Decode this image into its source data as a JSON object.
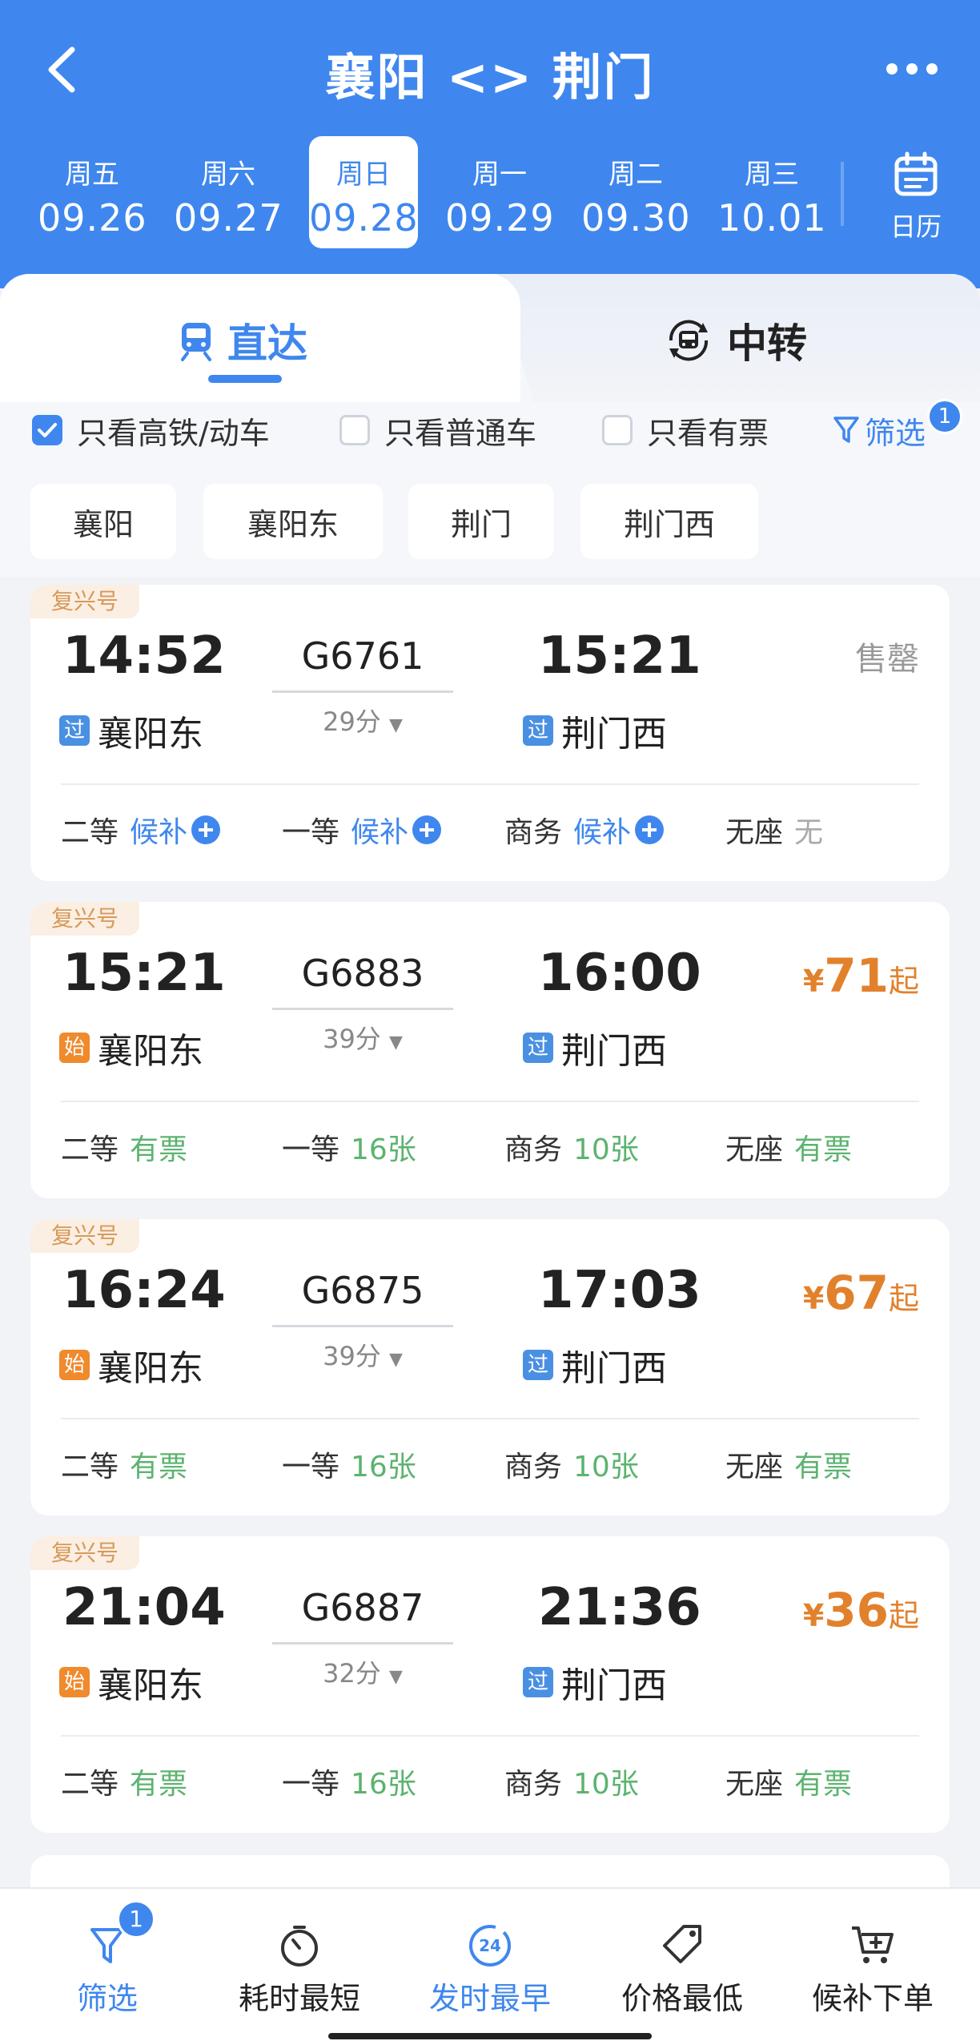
{
  "header": {
    "title": "襄阳 <> 荆门",
    "dates": [
      {
        "weekday": "周五",
        "date": "09.26"
      },
      {
        "weekday": "周六",
        "date": "09.27"
      },
      {
        "weekday": "周日",
        "date": "09.28",
        "selected": true
      },
      {
        "weekday": "周一",
        "date": "09.29"
      },
      {
        "weekday": "周二",
        "date": "09.30"
      },
      {
        "weekday": "周三",
        "date": "10.01"
      }
    ],
    "calendar_label": "日历"
  },
  "tabs": {
    "direct": "直达",
    "transfer": "中转"
  },
  "filters": {
    "high_speed": "只看高铁/动车",
    "high_speed_checked": true,
    "regular": "只看普通车",
    "regular_checked": false,
    "available": "只看有票",
    "available_checked": false,
    "filter_label": "筛选",
    "filter_badge": "1"
  },
  "stations": [
    "襄阳",
    "襄阳东",
    "荆门",
    "荆门西"
  ],
  "trains": [
    {
      "tag": "复兴号",
      "dep_time": "14:52",
      "arr_time": "15:21",
      "train_no": "G6761",
      "duration": "29分",
      "dep_mark": "过",
      "dep_station": "襄阳东",
      "arr_mark": "过",
      "arr_station": "荆门西",
      "sold_out": "售罄",
      "seats": [
        {
          "class": "二等",
          "status": "候补"
        },
        {
          "class": "一等",
          "status": "候补"
        },
        {
          "class": "商务",
          "status": "候补"
        },
        {
          "class": "无座",
          "status": "无"
        }
      ]
    },
    {
      "tag": "复兴号",
      "dep_time": "15:21",
      "arr_time": "16:00",
      "train_no": "G6883",
      "duration": "39分",
      "dep_mark": "始",
      "dep_station": "襄阳东",
      "arr_mark": "过",
      "arr_station": "荆门西",
      "price_symbol": "¥",
      "price": "71",
      "price_suffix": "起",
      "seats": [
        {
          "class": "二等",
          "status": "有票"
        },
        {
          "class": "一等",
          "status": "16张"
        },
        {
          "class": "商务",
          "status": "10张"
        },
        {
          "class": "无座",
          "status": "有票"
        }
      ]
    },
    {
      "tag": "复兴号",
      "dep_time": "16:24",
      "arr_time": "17:03",
      "train_no": "G6875",
      "duration": "39分",
      "dep_mark": "始",
      "dep_station": "襄阳东",
      "arr_mark": "过",
      "arr_station": "荆门西",
      "price_symbol": "¥",
      "price": "67",
      "price_suffix": "起",
      "seats": [
        {
          "class": "二等",
          "status": "有票"
        },
        {
          "class": "一等",
          "status": "16张"
        },
        {
          "class": "商务",
          "status": "10张"
        },
        {
          "class": "无座",
          "status": "有票"
        }
      ]
    },
    {
      "tag": "复兴号",
      "dep_time": "21:04",
      "arr_time": "21:36",
      "train_no": "G6887",
      "duration": "32分",
      "dep_mark": "始",
      "dep_station": "襄阳东",
      "arr_mark": "过",
      "arr_station": "荆门西",
      "price_symbol": "¥",
      "price": "36",
      "price_suffix": "起",
      "seats": [
        {
          "class": "二等",
          "status": "有票"
        },
        {
          "class": "一等",
          "status": "16张"
        },
        {
          "class": "商务",
          "status": "10张"
        },
        {
          "class": "无座",
          "status": "有票"
        }
      ]
    }
  ],
  "bottom_bar": {
    "filter": "筛选",
    "filter_badge": "1",
    "shortest": "耗时最短",
    "earliest": "发时最早",
    "earliest_icon_text": "24",
    "cheapest": "价格最低",
    "waitlist": "候补下单"
  },
  "colors": {
    "primary": "#3f87ee",
    "price": "#e2812c",
    "available": "#5cb36f",
    "start_mark": "#ef8a2d"
  }
}
